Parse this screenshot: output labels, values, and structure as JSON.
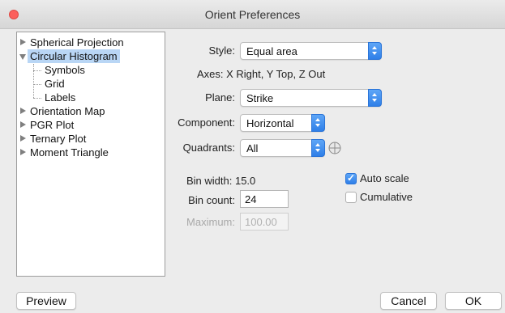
{
  "window": {
    "title": "Orient Preferences"
  },
  "tree": {
    "items": [
      {
        "label": "Spherical Projection",
        "expanded": false,
        "selected": false
      },
      {
        "label": "Circular Histogram",
        "expanded": true,
        "selected": true
      },
      {
        "label": "Symbols"
      },
      {
        "label": "Grid"
      },
      {
        "label": "Labels"
      },
      {
        "label": "Orientation Map",
        "expanded": false
      },
      {
        "label": "PGR Plot",
        "expanded": false
      },
      {
        "label": "Ternary Plot",
        "expanded": false
      },
      {
        "label": "Moment Triangle",
        "expanded": false
      }
    ]
  },
  "form": {
    "style_label": "Style:",
    "style_value": "Equal area",
    "axes_text": "Axes: X Right, Y Top, Z Out",
    "plane_label": "Plane:",
    "plane_value": "Strike",
    "component_label": "Component:",
    "component_value": "Horizontal",
    "quadrants_label": "Quadrants:",
    "quadrants_value": "All",
    "bin_width_text": "Bin width: 15.0",
    "bin_count_label": "Bin count:",
    "bin_count_value": "24",
    "maximum_label": "Maximum:",
    "maximum_value": "100.00",
    "auto_scale_label": "Auto scale",
    "auto_scale_checked": true,
    "cumulative_label": "Cumulative",
    "cumulative_checked": false
  },
  "buttons": {
    "preview": "Preview",
    "cancel": "Cancel",
    "ok": "OK"
  },
  "colors": {
    "accent": "#3b8cf0",
    "selection": "#b9d6f5",
    "close": "#fc605c"
  }
}
